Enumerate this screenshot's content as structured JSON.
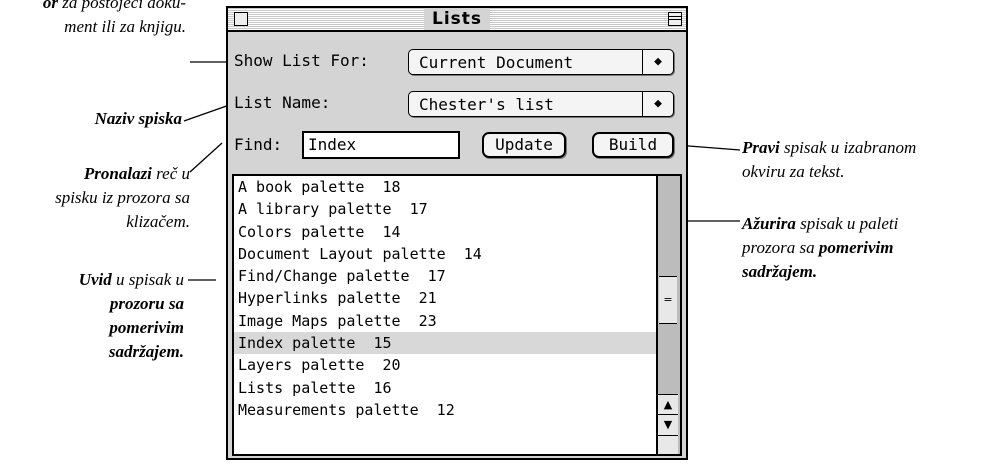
{
  "window": {
    "title": "Lists"
  },
  "controls": {
    "show_list_for_label": "Show List For:",
    "show_list_for_value": "Current Document",
    "list_name_label": "List Name:",
    "list_name_value": "Chester's list",
    "find_label": "Find:",
    "find_value": "Index",
    "update_label": "Update",
    "build_label": "Build"
  },
  "list": {
    "items": [
      "A book palette  18",
      "A library palette  17",
      "Colors palette  14",
      "Document Layout palette  14",
      "Find/Change palette  17",
      "Hyperlinks palette  21",
      "Image Maps palette  23",
      "Index palette  15",
      "Layers palette  20",
      "Lists palette  16",
      "Measurements palette  12"
    ],
    "selected_index": 7
  },
  "annotations": {
    "top_left_bold": "or",
    "top_left_rest_1": " za postojeći doku-",
    "top_left_rest_2": "ment ili za knjigu.",
    "naziv": "Naziv spiska",
    "pronalazi_bold": "Pronalazi",
    "pronalazi_rest_1": " reč u",
    "pronalazi_rest_2": "spisku iz prozora sa",
    "pronalazi_rest_3": "klizačem.",
    "uvid_bold": "Uvid",
    "uvid_rest_1": " u spisak u",
    "uvid_bold_2": "prozoru sa",
    "uvid_bold_3": "pomerivim",
    "uvid_bold_4": "sadržajem.",
    "pravi_bold": "Pravi",
    "pravi_rest_1": " spisak u izabranom",
    "pravi_rest_2": "okviru za tekst.",
    "azurira_bold": "Ažurira",
    "azurira_rest_1": " spisak u paleti",
    "azurira_rest_2": "prozora sa ",
    "azurira_bold_2": "pomerivim",
    "azurira_bold_3": "sadržajem."
  }
}
